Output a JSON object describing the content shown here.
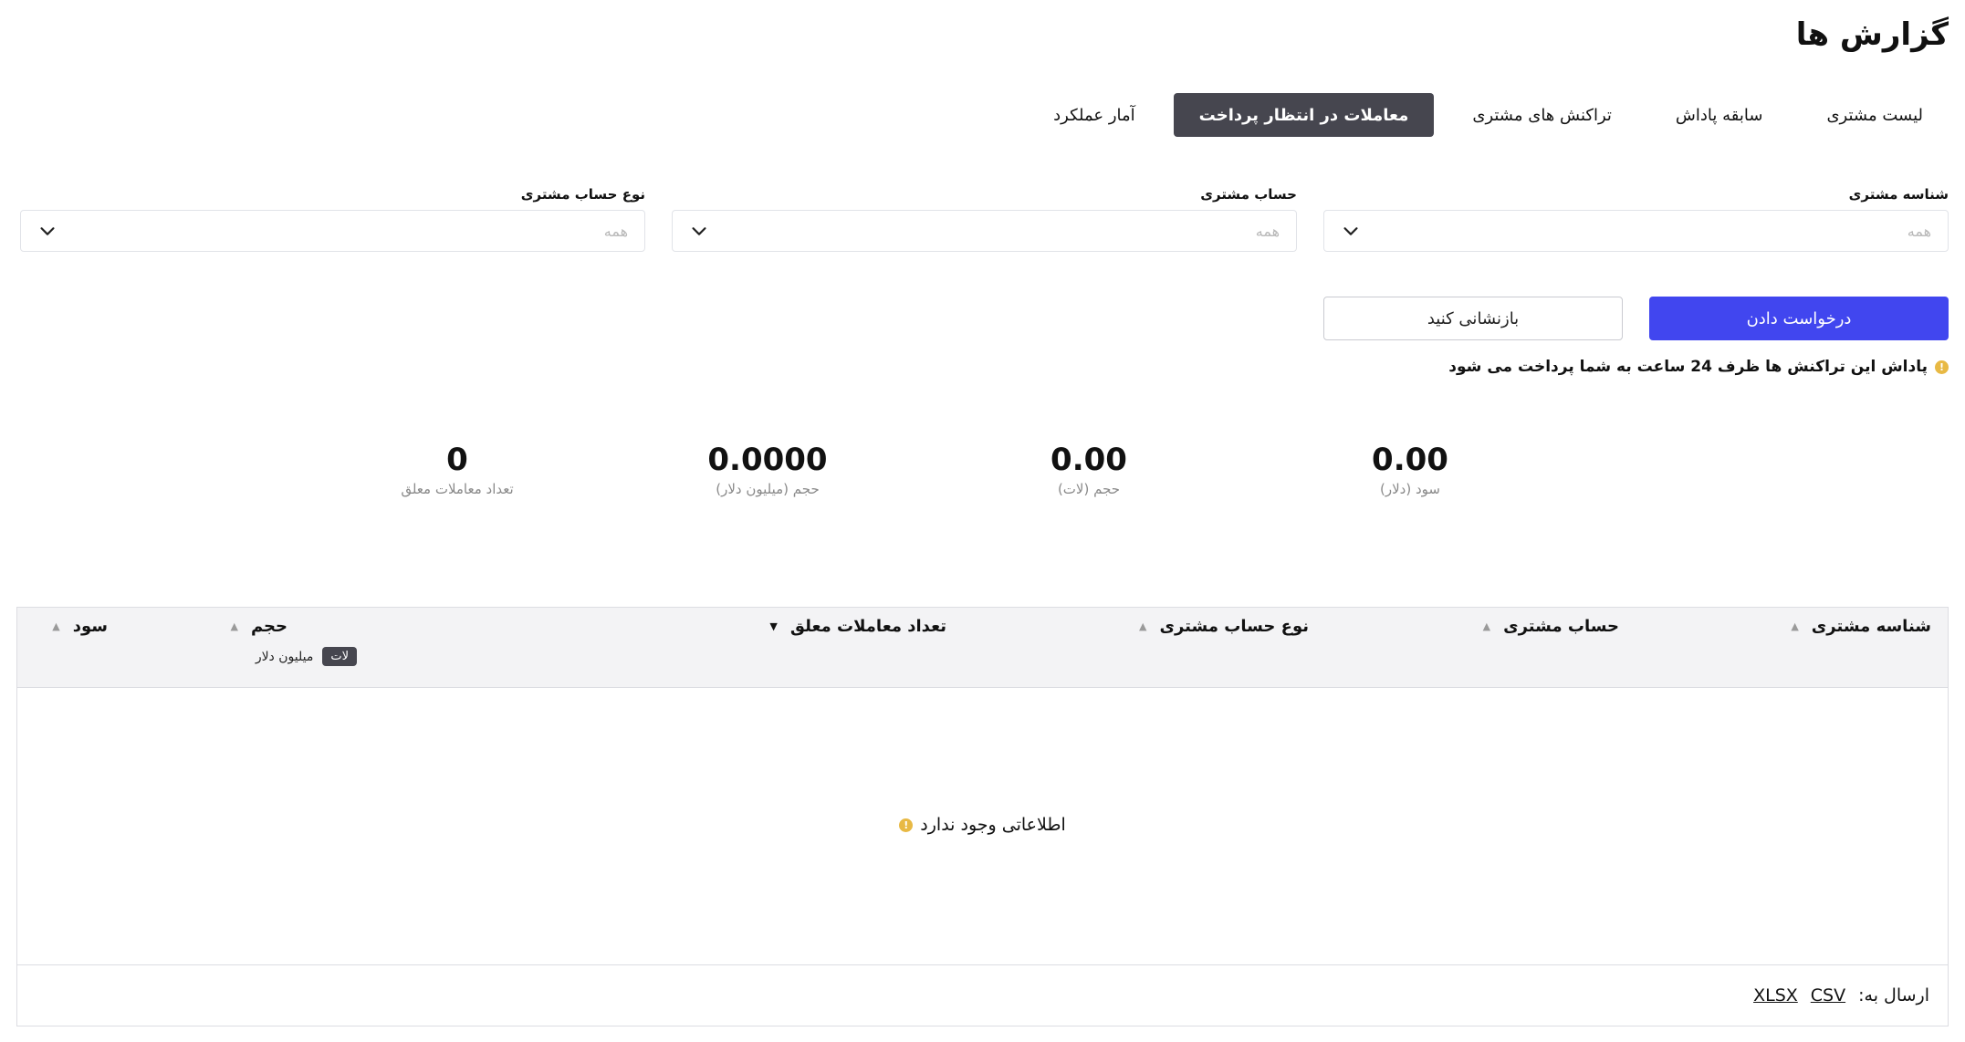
{
  "page": {
    "title": "گزارش ها"
  },
  "tabs": [
    {
      "label": "لیست مشتری",
      "active": false
    },
    {
      "label": "سابقه پاداش",
      "active": false
    },
    {
      "label": "تراکنش های مشتری",
      "active": false
    },
    {
      "label": "معاملات در انتظار پرداخت",
      "active": true
    },
    {
      "label": "آمار عملکرد",
      "active": false
    }
  ],
  "filters": [
    {
      "label": "شناسه مشتری",
      "value": "همه"
    },
    {
      "label": "حساب مشتری",
      "value": "همه"
    },
    {
      "label": "نوع حساب مشتری",
      "value": "همه"
    }
  ],
  "actions": {
    "submit_label": "درخواست دادن",
    "reset_label": "بازنشانی کنید"
  },
  "notice": {
    "text": "پاداش این تراکنش ها ظرف 24 ساعت به شما پرداخت می شود"
  },
  "stats": [
    {
      "value": "0.00",
      "label": "سود (دلار)"
    },
    {
      "value": "0.00",
      "label": "حجم (لات)"
    },
    {
      "value": "0.0000",
      "label": "حجم (میلیون دلار)"
    },
    {
      "value": "0",
      "label": "تعداد معاملات معلق"
    }
  ],
  "table": {
    "columns": [
      {
        "label": "شناسه مشتری"
      },
      {
        "label": "حساب مشتری"
      },
      {
        "label": "نوع حساب مشتری"
      },
      {
        "label": "تعداد معاملات معلق"
      },
      {
        "label": "حجم"
      },
      {
        "label": "سود"
      }
    ],
    "volume_units": {
      "lot": "لات",
      "million_usd": "میلیون دلار"
    },
    "empty_text": "اطلاعاتی وجود ندارد",
    "export": {
      "label": "ارسال به:",
      "csv": "CSV",
      "xlsx": "XLSX"
    }
  },
  "colors": {
    "primary": "#4146ef",
    "active_tab": "#46464f",
    "info": "#e8b944"
  },
  "icons": {
    "dropdown": "chevron-down-icon",
    "info": "info-icon",
    "sort_up": "sort-up-icon",
    "sort_down": "sort-down-icon"
  }
}
